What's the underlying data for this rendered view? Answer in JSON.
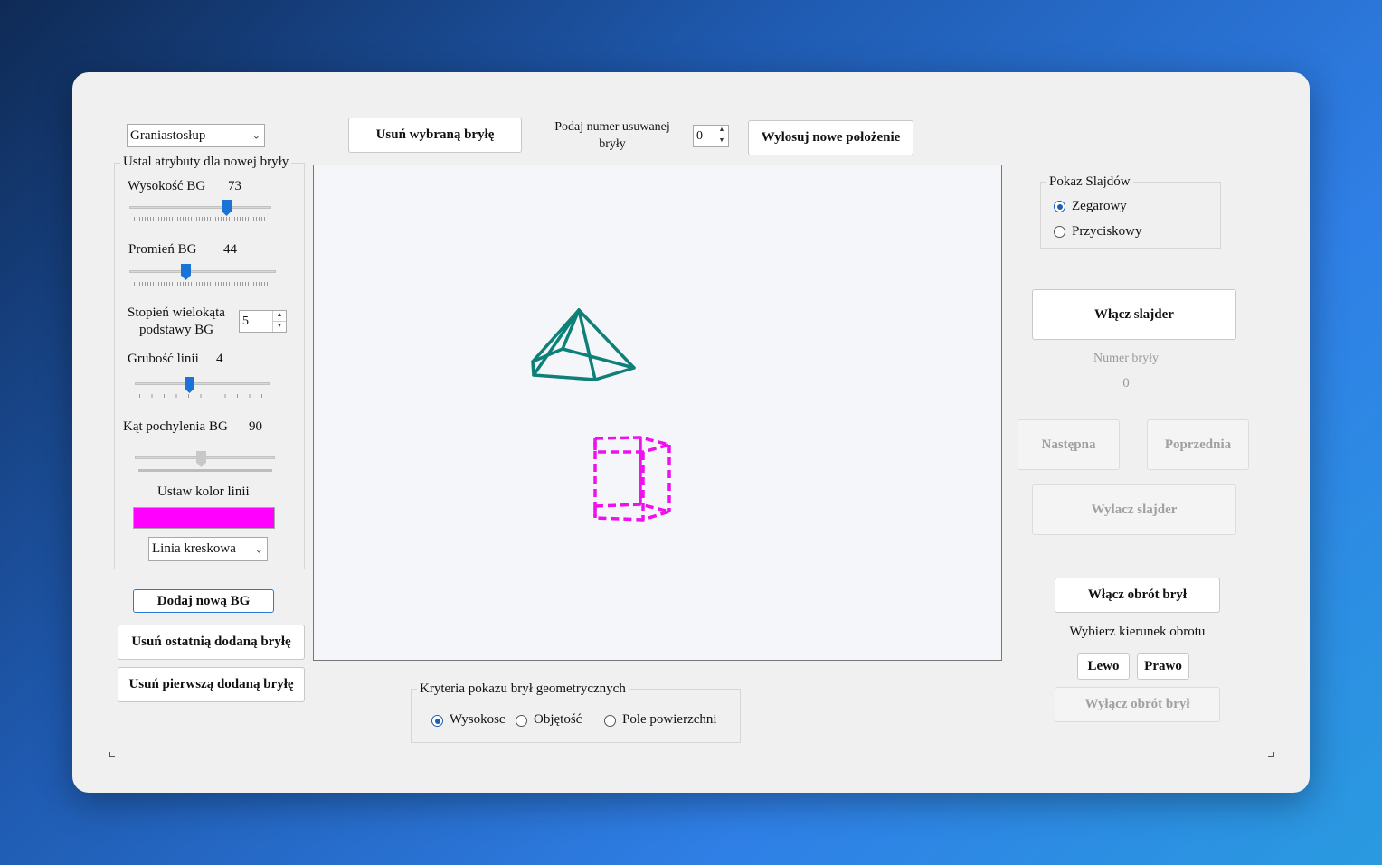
{
  "left_panel": {
    "shape_select": "Graniastosłup",
    "attributes_group_title": "Ustal atrybuty dla nowej bryły",
    "height_label": "Wysokość BG",
    "height_value": "73",
    "radius_label": "Promień BG",
    "radius_value": "44",
    "polygon_degree_label_1": "Stopień wielokąta",
    "polygon_degree_label_2": "podstawy BG",
    "polygon_degree_value": "5",
    "line_width_label": "Grubość linii",
    "line_width_value": "4",
    "tilt_label": "Kąt pochylenia BG",
    "tilt_value": "90",
    "color_label": "Ustaw kolor linii",
    "line_color": "#ff00ff",
    "line_style_select": "Linia kreskowa",
    "add_button": "Dodaj nową BG",
    "remove_last_button": "Usuń ostatnią dodaną bryłę",
    "remove_first_button": "Usuń pierwszą dodaną bryłę"
  },
  "top_bar": {
    "remove_selected_button": "Usuń wybraną bryłę",
    "remove_number_label_1": "Podaj numer usuwanej",
    "remove_number_label_2": "bryły",
    "remove_number_value": "0",
    "reposition_button": "Wylosuj nowe położenie"
  },
  "canvas": {
    "pyramid_color": "#0f8078",
    "prism_color": "#ee11ee"
  },
  "criteria": {
    "title": "Kryteria pokazu brył geometrycznych",
    "options": [
      "Wysokosc",
      "Objętość",
      "Pole powierzchni"
    ],
    "selected": "Wysokosc"
  },
  "right_panel": {
    "slideshow_title": "Pokaz Slajdów",
    "slideshow_options": [
      "Zegarowy",
      "Przyciskowy"
    ],
    "slideshow_selected": "Zegarowy",
    "enable_slider_button": "Włącz slajder",
    "solid_number_label": "Numer bryły",
    "solid_number_value": "0",
    "next_button": "Następna",
    "prev_button": "Poprzednia",
    "disable_slider_button": "Wylacz slajder",
    "enable_rotation_button": "Włącz obrót brył",
    "rotation_direction_label": "Wybierz kierunek obrotu",
    "left_button": "Lewo",
    "right_button": "Prawo",
    "disable_rotation_button": "Wyłącz obrót brył"
  }
}
